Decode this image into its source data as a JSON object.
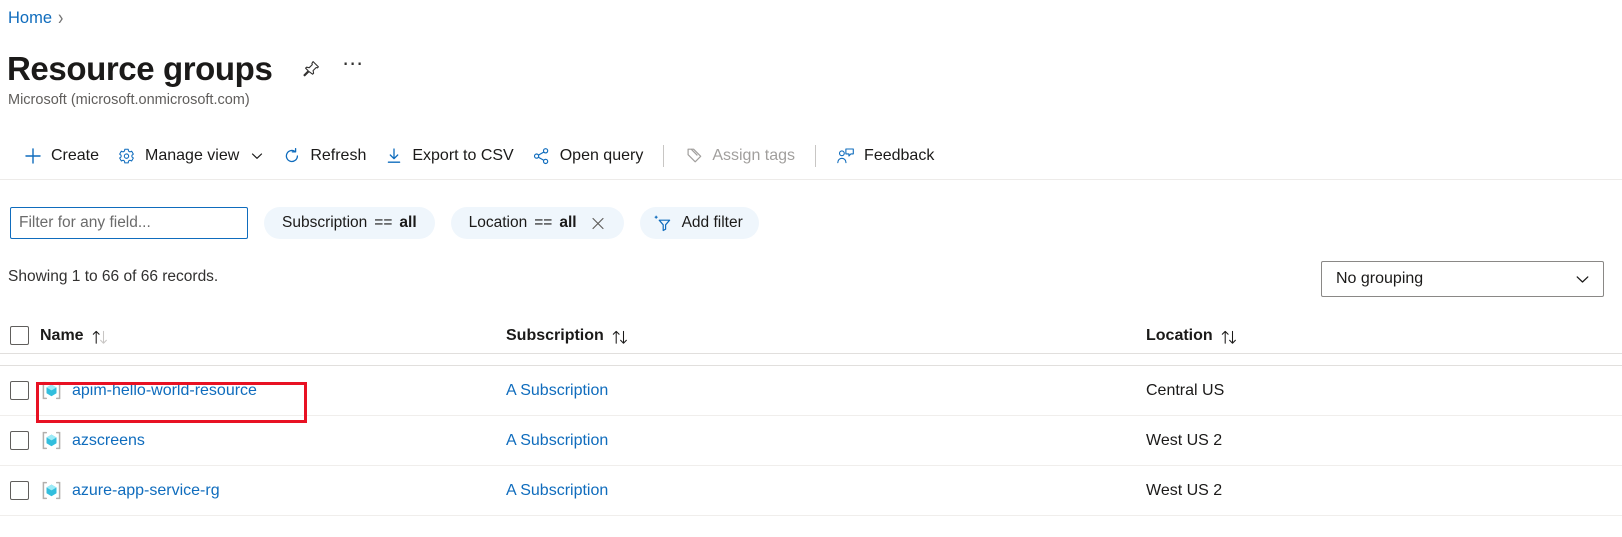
{
  "breadcrumb": {
    "home_label": "Home",
    "separator": "›"
  },
  "header": {
    "title": "Resource groups",
    "pin_icon": "pin-icon",
    "more_icon": "ellipsis-icon",
    "more_label": "⋯",
    "subtitle": "Microsoft (microsoft.onmicrosoft.com)"
  },
  "toolbar": {
    "create_label": "Create",
    "manage_view_label": "Manage view",
    "refresh_label": "Refresh",
    "export_csv_label": "Export to CSV",
    "open_query_label": "Open query",
    "assign_tags_label": "Assign tags",
    "feedback_label": "Feedback"
  },
  "filters": {
    "search_placeholder": "Filter for any field...",
    "search_value": "",
    "subscription_pill": {
      "field": "Subscription",
      "operator": "==",
      "value": "all"
    },
    "location_pill": {
      "field": "Location",
      "operator": "==",
      "value": "all",
      "clear_icon": "close-icon"
    },
    "add_filter_label": "Add filter"
  },
  "results": {
    "showing_text": "Showing 1 to 66 of 66 records.",
    "grouping_value": "No grouping"
  },
  "table": {
    "columns": [
      {
        "label": "Name",
        "sort_icon": "sort-icon"
      },
      {
        "label": "Subscription",
        "sort_icon": "sort-icon"
      },
      {
        "label": "Location",
        "sort_icon": "sort-icon"
      }
    ],
    "rows": [
      {
        "name": "apim-hello-world-resource",
        "subscription": "A Subscription",
        "location": "Central US",
        "highlighted": true
      },
      {
        "name": "azscreens",
        "subscription": "A Subscription",
        "location": "West US 2",
        "highlighted": false
      },
      {
        "name": "azure-app-service-rg",
        "subscription": "A Subscription",
        "location": "West US 2",
        "highlighted": false
      }
    ],
    "clipped_row": {
      "name": "",
      "subscription": "",
      "location": ""
    }
  },
  "colors": {
    "link": "#0f6cbd",
    "accent": "#0f6cbd",
    "highlight_border": "#e81123",
    "pill_background": "#eff6fc",
    "resource_icon": "#32bedd"
  }
}
